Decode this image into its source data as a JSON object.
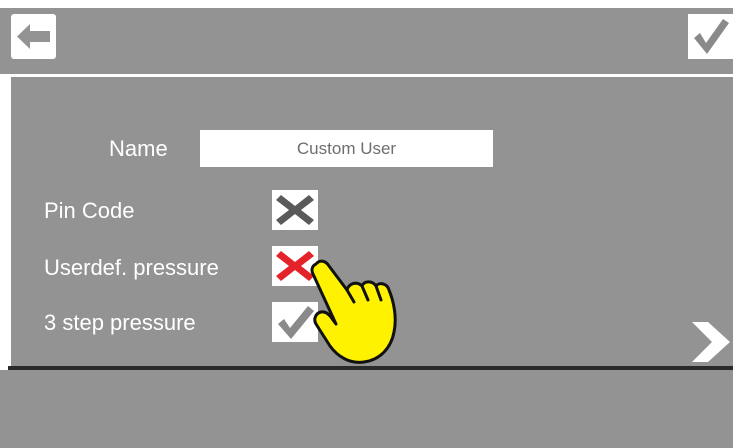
{
  "header": {
    "back_icon": "arrow-left-icon",
    "confirm_icon": "checkmark-icon"
  },
  "form": {
    "name_label": "Name",
    "name_value": "Custom User",
    "pin_code_label": "Pin Code",
    "pin_code_state": "disabled",
    "userdef_pressure_label": "Userdef. pressure",
    "userdef_pressure_state": "disabled-selected",
    "three_step_pressure_label": "3 step pressure",
    "three_step_pressure_state": "enabled"
  },
  "navigation": {
    "next_icon": "chevron-right-icon"
  },
  "colors": {
    "panel_bg": "#939393",
    "cross_gray": "#5a5a5a",
    "cross_red": "#e3222a",
    "check_gray": "#8a8a8a",
    "hand_yellow": "#fff200"
  }
}
